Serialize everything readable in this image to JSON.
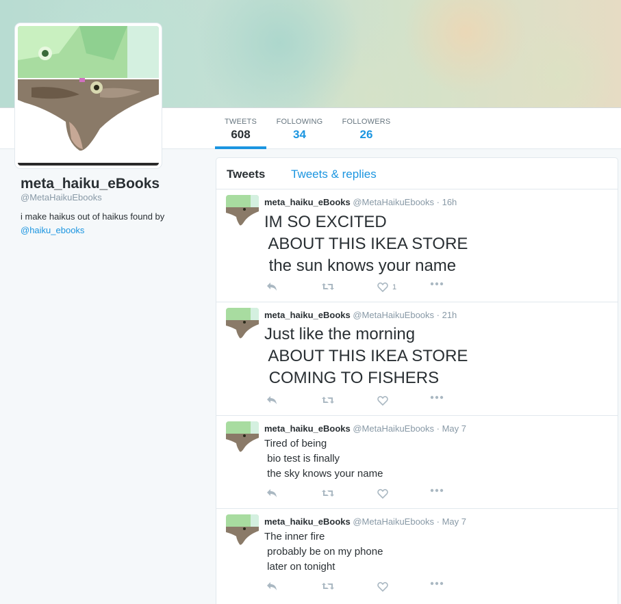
{
  "profile": {
    "name": "meta_haiku_eBooks",
    "handle": "@MetaHaikuEbooks",
    "bio_text": "i make haikus out of haikus found by",
    "bio_mention": "@haiku_ebooks"
  },
  "stats": [
    {
      "label": "TWEETS",
      "value": "608",
      "active": true
    },
    {
      "label": "FOLLOWING",
      "value": "34",
      "active": false
    },
    {
      "label": "FOLLOWERS",
      "value": "26",
      "active": false
    }
  ],
  "tabs": {
    "tweets": "Tweets",
    "replies": "Tweets & replies"
  },
  "tweets": [
    {
      "name": "meta_haiku_eBooks",
      "meta": " @MetaHaikuEbooks · 16h",
      "text": "IM SO EXCITED\n ABOUT THIS IKEA STORE\n the sun knows your name",
      "size": "large",
      "like_count": "1"
    },
    {
      "name": "meta_haiku_eBooks",
      "meta": " @MetaHaikuEbooks · 21h",
      "text": "Just like the morning\n ABOUT THIS IKEA STORE\n COMING TO FISHERS",
      "size": "large",
      "like_count": ""
    },
    {
      "name": "meta_haiku_eBooks",
      "meta": " @MetaHaikuEbooks · May 7",
      "text": "Tired of being\n bio test is finally\n the sky knows your name",
      "size": "small",
      "like_count": ""
    },
    {
      "name": "meta_haiku_eBooks",
      "meta": " @MetaHaikuEbooks · May 7",
      "text": "The inner fire\n probably be on my phone\n later on tonight",
      "size": "small",
      "like_count": ""
    }
  ],
  "icons": {
    "reply": "reply-icon",
    "retweet": "retweet-icon",
    "like": "like-icon",
    "more": "more-icon"
  },
  "colors": {
    "accent": "#1b95e0",
    "text": "#292f33",
    "muted": "#8899a6",
    "icon": "#aab8c2"
  }
}
